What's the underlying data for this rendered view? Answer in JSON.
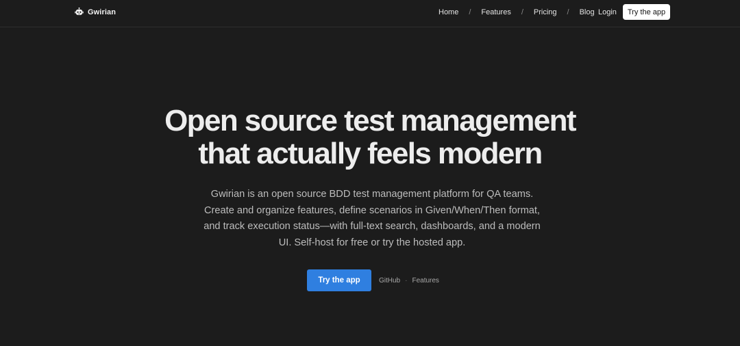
{
  "header": {
    "brand_name": "Gwirian",
    "brand_icon": "robot-icon",
    "nav": [
      {
        "label": "Home"
      },
      {
        "label": "Features"
      },
      {
        "label": "Pricing"
      },
      {
        "label": "Blog"
      }
    ],
    "nav_separator": "/",
    "login_label": "Login",
    "cta_label": "Try the app"
  },
  "hero": {
    "title_line1": "Open source test management",
    "title_line2": "that actually feels modern",
    "description": "Gwirian is an open source BDD test management platform for QA teams. Create and organize features, define scenarios in Given/When/Then format, and track execution status—with full-text search, dashboards, and a modern UI. Self-host for free or try the hosted app.",
    "cta_label": "Try the app",
    "secondary_links": [
      {
        "label": "GitHub"
      },
      {
        "label": "Features"
      }
    ],
    "secondary_separator": "·"
  },
  "colors": {
    "background": "#1c1c1c",
    "accent": "#2f7fe0",
    "header_cta_bg": "#ffffff"
  }
}
